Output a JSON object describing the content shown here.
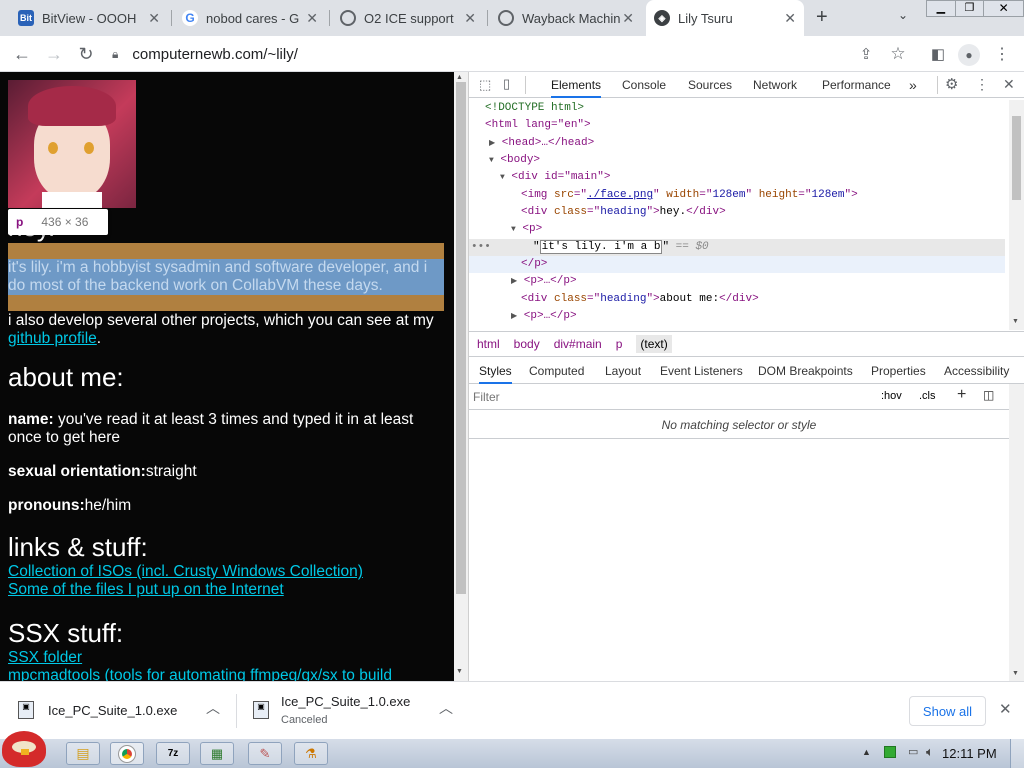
{
  "tabs": [
    {
      "title": "BitView - OOOH",
      "icon": "bitview-icon"
    },
    {
      "title": "nobod cares - G",
      "icon": "google-icon"
    },
    {
      "title": "O2 ICE support",
      "icon": "globe-icon"
    },
    {
      "title": "Wayback Machin",
      "icon": "globe-icon"
    },
    {
      "title": "Lily Tsuru",
      "icon": "site-icon"
    }
  ],
  "address": {
    "url": "computernewb.com/~lily/"
  },
  "page": {
    "tooltip_tag": "p",
    "tooltip_size": "436 × 36",
    "heading_partial": "hey.",
    "intro": "it's lily. i'm a hobbyist sysadmin and software developer, and i do most of the backend work on CollabVM these days.",
    "para2_prefix": "i also develop several other projects, which you can see at my ",
    "para2_link": "github profile",
    "para2_suffix": ".",
    "about_heading": "about me:",
    "name_label": "name:",
    "name_text": " you've read it at least 3 times and typed it in at least once to get here",
    "orientation_label": "sexual orientation:",
    "orientation_text": "straight",
    "pronouns_label": "pronouns:",
    "pronouns_text": "he/him",
    "links_heading": "links & stuff:",
    "link1": "Collection of ISOs (incl. Crusty Windows Collection)",
    "link2": "Some of the files I put up on the Internet",
    "ssx_heading": "SSX stuff:",
    "ssx_link1": "SSX folder",
    "ssx_link2": "mpcmadtools (tools for automating ffmpeg/gx/sx to build"
  },
  "devtools": {
    "tabs": [
      "Elements",
      "Console",
      "Sources",
      "Network",
      "Performance"
    ],
    "more": "»",
    "dom": {
      "doctype": "<!DOCTYPE html>",
      "html_open": "<html lang=\"en\">",
      "head": "<head>…</head>",
      "body": "<body>",
      "div_main": "<div id=\"main\">",
      "img_src": "./face.png",
      "img_w": "128em",
      "img_h": "128em",
      "div_heading": "hey.",
      "p_open": "<p>",
      "text_edit": "it's lily. i'm a b",
      "dollar": "== $0",
      "p_close": "</p>",
      "p_collapsed": "<p>…</p>",
      "about_div": "about me:",
      "p_collapsed2": "<p>…</p>"
    },
    "breadcrumbs": [
      "html",
      "body",
      "div#main",
      "p",
      "(text)"
    ],
    "subtabs": [
      "Styles",
      "Computed",
      "Layout",
      "Event Listeners",
      "DOM Breakpoints",
      "Properties",
      "Accessibility"
    ],
    "filter_placeholder": "Filter",
    "hov": ":hov",
    "cls": ".cls",
    "no_match": "No matching selector or style"
  },
  "downloads": [
    {
      "name": "Ice_PC_Suite_1.0.exe",
      "status": ""
    },
    {
      "name": "Ice_PC_Suite_1.0.exe",
      "status": "Canceled"
    }
  ],
  "show_all": "Show all",
  "clock": "12:11 PM"
}
